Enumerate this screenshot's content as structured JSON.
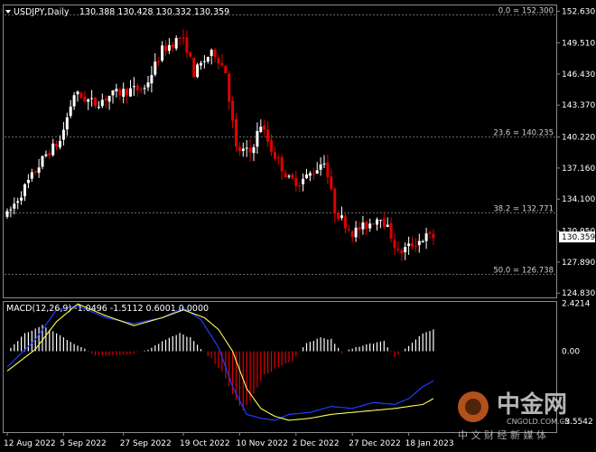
{
  "header": {
    "symbol": "USDJPY,Daily",
    "ohlc": "130.388 130.428 130.332 130.359"
  },
  "macd_header": "MACD(12,26,9) -1.0496 -1.5112 0.6001 0.0000",
  "price_axis": {
    "ticks": [
      {
        "value": 152.63,
        "label": "152.630"
      },
      {
        "value": 149.51,
        "label": "149.510"
      },
      {
        "value": 146.43,
        "label": "146.430"
      },
      {
        "value": 143.37,
        "label": "143.370"
      },
      {
        "value": 140.22,
        "label": "140.220"
      },
      {
        "value": 137.16,
        "label": "137.160"
      },
      {
        "value": 134.1,
        "label": "134.100"
      },
      {
        "value": 130.95,
        "label": "130.950"
      },
      {
        "value": 127.89,
        "label": "127.890"
      },
      {
        "value": 124.83,
        "label": "124.830"
      }
    ],
    "current_price": {
      "value": 130.359,
      "label": "130.359"
    },
    "min": 124.4,
    "max": 153.2
  },
  "macd_axis": {
    "ticks": [
      {
        "value": 2.4214,
        "label": "2.4214"
      },
      {
        "value": 0.0,
        "label": "0.00"
      },
      {
        "value": -3.5542,
        "label": "-3.5542"
      }
    ],
    "min": -4.1,
    "max": 2.5
  },
  "fib_levels": [
    {
      "value": 152.3,
      "label": "0.0 = 152.300"
    },
    {
      "value": 140.235,
      "label": "23.6 = 140.235"
    },
    {
      "value": 132.771,
      "label": "38.2 = 132.771"
    },
    {
      "value": 126.738,
      "label": "50.0 = 126.738"
    }
  ],
  "date_axis": [
    {
      "index": 0,
      "label": "12 Aug 2022"
    },
    {
      "index": 16,
      "label": "5 Sep 2022"
    },
    {
      "index": 33,
      "label": "27 Sep 2022"
    },
    {
      "index": 50,
      "label": "19 Oct 2022"
    },
    {
      "index": 66,
      "label": "10 Nov 2022"
    },
    {
      "index": 82,
      "label": "2 Dec 2022"
    },
    {
      "index": 98,
      "label": "27 Dec 2022"
    },
    {
      "index": 114,
      "label": "18 Jan 2023"
    }
  ],
  "colors": {
    "background": "#000000",
    "grid": "#8a8a8a",
    "bull": "#ffffff",
    "bear": "#e00000",
    "macd_pos": "#ffffff",
    "macd_neg": "#e00000",
    "macd_line": "#1e3cff",
    "signal_line": "#ffff55",
    "axis_text": "#ffffff"
  },
  "watermark": {
    "brand": "中金网",
    "domain": "CNGOLD.COM.CN",
    "slogan": "中 文 财 经 新 媒 体"
  },
  "chart_data": {
    "type": "candlestick",
    "title": "USDJPY,Daily",
    "anchors": [
      [
        0,
        132.5
      ],
      [
        6,
        135.8
      ],
      [
        11,
        138.5
      ],
      [
        15,
        139.8
      ],
      [
        19,
        144.5
      ],
      [
        25,
        143.5
      ],
      [
        29,
        144.3
      ],
      [
        34,
        144.8
      ],
      [
        39,
        145.0
      ],
      [
        44,
        148.8
      ],
      [
        49,
        150.0
      ],
      [
        51,
        149.0
      ],
      [
        53,
        146.5
      ],
      [
        57,
        148.2
      ],
      [
        59,
        148.5
      ],
      [
        62,
        146.7
      ],
      [
        65,
        139.0
      ],
      [
        69,
        138.7
      ],
      [
        72,
        141.5
      ],
      [
        75,
        139.0
      ],
      [
        80,
        136.0
      ],
      [
        83,
        135.8
      ],
      [
        87,
        136.8
      ],
      [
        90,
        138.0
      ],
      [
        93,
        133.0
      ],
      [
        98,
        130.8
      ],
      [
        102,
        131.5
      ],
      [
        106,
        132.5
      ],
      [
        109,
        130.5
      ],
      [
        111,
        128.7
      ],
      [
        113,
        129.2
      ],
      [
        116,
        129.8
      ],
      [
        119,
        130.4
      ],
      [
        121,
        130.36
      ]
    ],
    "macd": {
      "histogram_anchors": [
        [
          0,
          0.0
        ],
        [
          5,
          0.9
        ],
        [
          10,
          1.3
        ],
        [
          15,
          0.8
        ],
        [
          20,
          0.3
        ],
        [
          25,
          -0.2
        ],
        [
          30,
          -0.2
        ],
        [
          35,
          -0.15
        ],
        [
          40,
          0.1
        ],
        [
          44,
          0.5
        ],
        [
          49,
          0.9
        ],
        [
          52,
          0.7
        ],
        [
          55,
          0.1
        ],
        [
          58,
          -0.4
        ],
        [
          61,
          -1.0
        ],
        [
          64,
          -2.2
        ],
        [
          67,
          -3.0
        ],
        [
          69,
          -2.5
        ],
        [
          73,
          -1.2
        ],
        [
          77,
          -0.8
        ],
        [
          81,
          -0.5
        ],
        [
          85,
          0.4
        ],
        [
          89,
          0.7
        ],
        [
          92,
          0.6
        ],
        [
          95,
          -0.1
        ],
        [
          99,
          0.2
        ],
        [
          103,
          0.4
        ],
        [
          107,
          0.5
        ],
        [
          110,
          -0.3
        ],
        [
          114,
          0.3
        ],
        [
          118,
          0.9
        ],
        [
          121,
          1.1
        ]
      ],
      "macd_line_anchors": [
        [
          0,
          -0.8
        ],
        [
          8,
          0.6
        ],
        [
          14,
          2.1
        ],
        [
          20,
          2.3
        ],
        [
          28,
          1.7
        ],
        [
          36,
          1.4
        ],
        [
          44,
          1.7
        ],
        [
          50,
          2.2
        ],
        [
          55,
          1.6
        ],
        [
          60,
          0.2
        ],
        [
          64,
          -1.8
        ],
        [
          68,
          -3.2
        ],
        [
          72,
          -3.4
        ],
        [
          76,
          -3.5
        ],
        [
          80,
          -3.2
        ],
        [
          86,
          -3.1
        ],
        [
          92,
          -2.8
        ],
        [
          98,
          -2.9
        ],
        [
          104,
          -2.6
        ],
        [
          110,
          -2.7
        ],
        [
          114,
          -2.4
        ],
        [
          118,
          -1.8
        ],
        [
          121,
          -1.5
        ]
      ],
      "signal_line_anchors": [
        [
          0,
          -1.0
        ],
        [
          8,
          0.1
        ],
        [
          14,
          1.5
        ],
        [
          20,
          2.4
        ],
        [
          28,
          1.8
        ],
        [
          36,
          1.3
        ],
        [
          44,
          1.7
        ],
        [
          50,
          2.1
        ],
        [
          56,
          1.7
        ],
        [
          60,
          1.1
        ],
        [
          64,
          0.0
        ],
        [
          68,
          -1.9
        ],
        [
          72,
          -2.9
        ],
        [
          76,
          -3.3
        ],
        [
          80,
          -3.5
        ],
        [
          86,
          -3.4
        ],
        [
          92,
          -3.2
        ],
        [
          98,
          -3.1
        ],
        [
          104,
          -3.0
        ],
        [
          110,
          -2.9
        ],
        [
          114,
          -2.8
        ],
        [
          118,
          -2.7
        ],
        [
          121,
          -2.4
        ]
      ]
    }
  }
}
